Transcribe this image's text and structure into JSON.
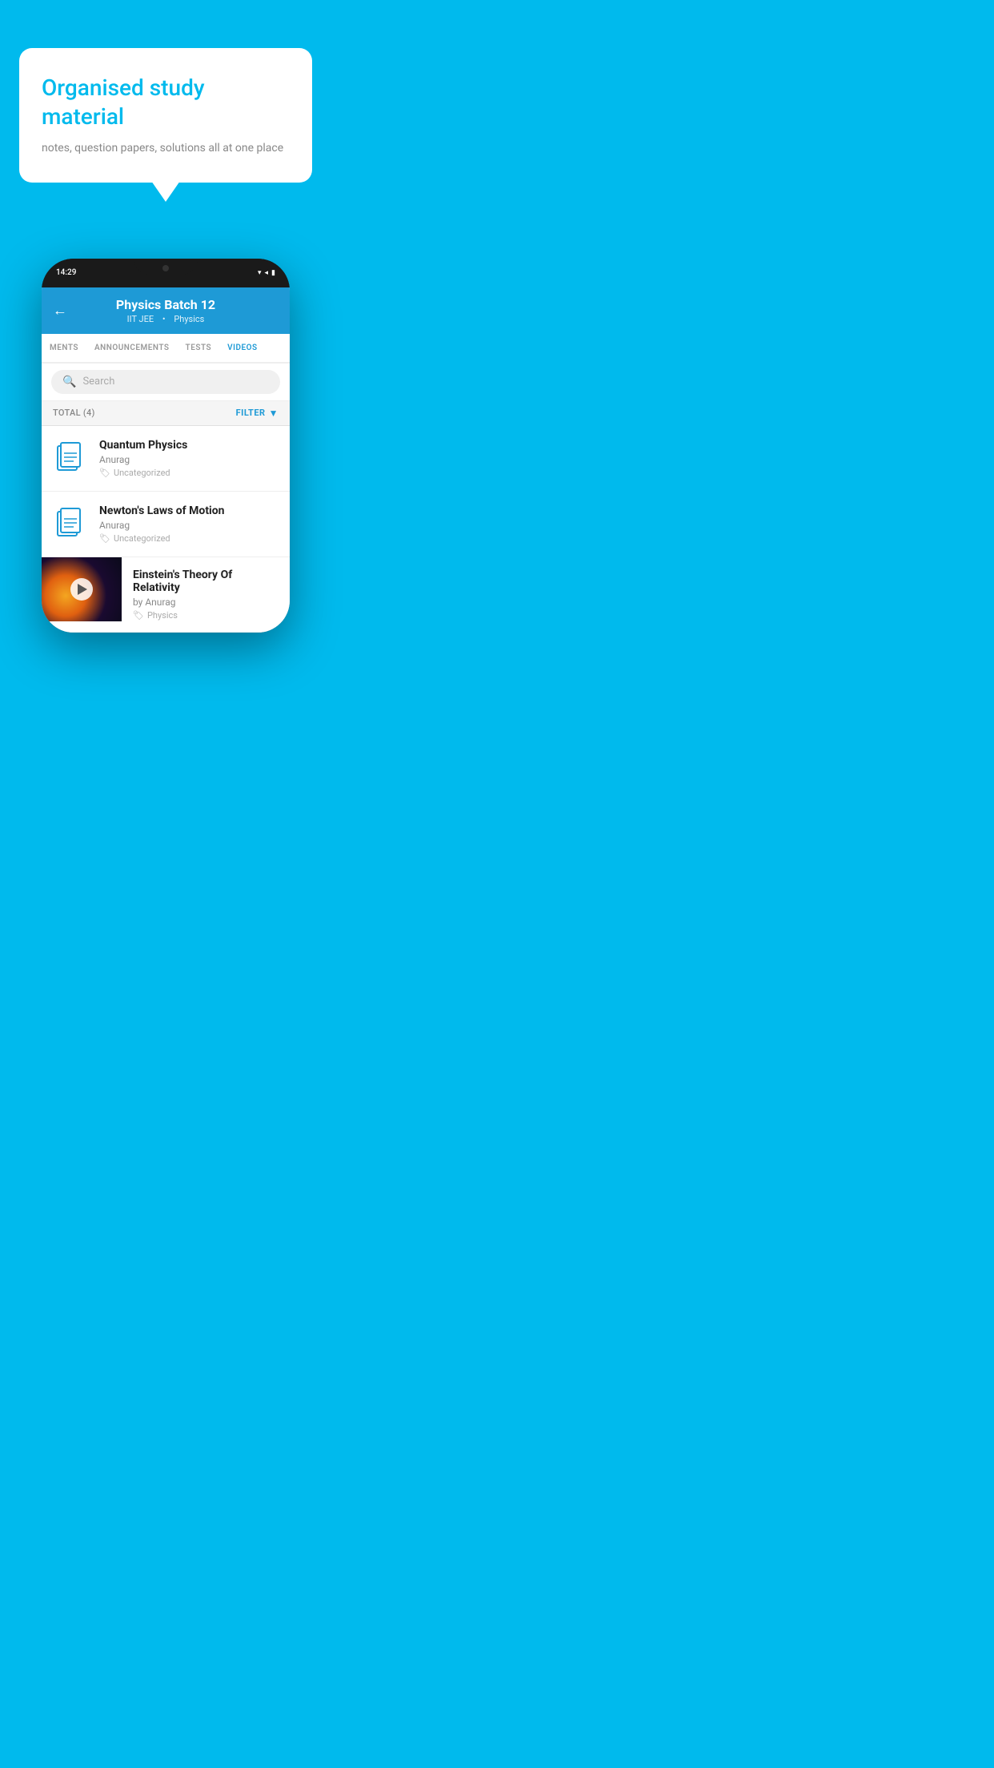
{
  "background_color": "#00BAED",
  "bubble": {
    "title": "Organised study material",
    "subtitle": "notes, question papers, solutions all at one place"
  },
  "phone": {
    "status_bar": {
      "time": "14:29",
      "icons": "▾ ◂ ▮"
    },
    "header": {
      "back_icon": "←",
      "title": "Physics Batch 12",
      "subtitle_part1": "IIT JEE",
      "subtitle_part2": "Physics"
    },
    "tabs": [
      {
        "label": "MENTS",
        "active": false
      },
      {
        "label": "ANNOUNCEMENTS",
        "active": false
      },
      {
        "label": "TESTS",
        "active": false
      },
      {
        "label": "VIDEOS",
        "active": true
      }
    ],
    "search": {
      "placeholder": "Search"
    },
    "filter": {
      "total_label": "TOTAL (4)",
      "filter_label": "FILTER"
    },
    "videos": [
      {
        "id": 1,
        "title": "Quantum Physics",
        "author": "Anurag",
        "tag": "Uncategorized",
        "has_thumb": false
      },
      {
        "id": 2,
        "title": "Newton's Laws of Motion",
        "author": "Anurag",
        "tag": "Uncategorized",
        "has_thumb": false
      },
      {
        "id": 3,
        "title": "Einstein's Theory Of Relativity",
        "author": "by Anurag",
        "tag": "Physics",
        "has_thumb": true
      }
    ]
  }
}
